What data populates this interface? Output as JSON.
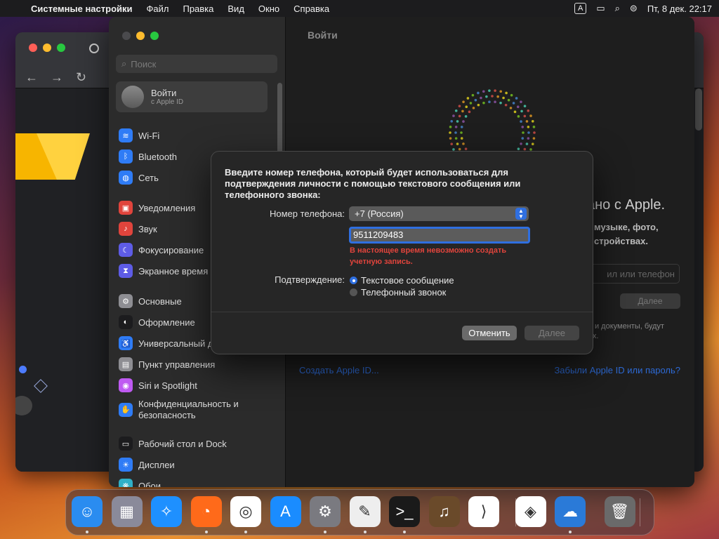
{
  "menubar": {
    "app_name": "Системные настройки",
    "items": [
      "Файл",
      "Правка",
      "Вид",
      "Окно",
      "Справка"
    ],
    "keyboard_indicator": "A",
    "datetime": "Пт, 8 дек.  22:17"
  },
  "settings": {
    "search_placeholder": "Поиск",
    "account": {
      "title": "Войти",
      "subtitle": "с Apple ID"
    },
    "sidebar": [
      {
        "label": "Wi-Fi",
        "icon": "wifi-icon",
        "color": "#2f7cf6",
        "glyph": "≋"
      },
      {
        "label": "Bluetooth",
        "icon": "bluetooth-icon",
        "color": "#2f7cf6",
        "glyph": "ᛒ"
      },
      {
        "label": "Сеть",
        "icon": "network-icon",
        "color": "#2f7cf6",
        "glyph": "◍"
      },
      {
        "label": "Уведомления",
        "icon": "notifications-icon",
        "color": "#e0443c",
        "glyph": "▣"
      },
      {
        "label": "Звук",
        "icon": "sound-icon",
        "color": "#e0443c",
        "glyph": "♪"
      },
      {
        "label": "Фокусирование",
        "icon": "focus-icon",
        "color": "#5e5ce6",
        "glyph": "☾"
      },
      {
        "label": "Экранное время",
        "icon": "screen-time-icon",
        "color": "#5e5ce6",
        "glyph": "⧗"
      },
      {
        "label": "Основные",
        "icon": "general-icon",
        "color": "#8e8e93",
        "glyph": "⚙"
      },
      {
        "label": "Оформление",
        "icon": "appearance-icon",
        "color": "#1c1c1e",
        "glyph": "◐"
      },
      {
        "label": "Универсальный доступ",
        "icon": "accessibility-icon",
        "color": "#2f7cf6",
        "glyph": "♿"
      },
      {
        "label": "Пункт управления",
        "icon": "control-center-icon",
        "color": "#8e8e93",
        "glyph": "▤"
      },
      {
        "label": "Siri и Spotlight",
        "icon": "siri-icon",
        "color": "#bf5af2",
        "glyph": "◉"
      },
      {
        "label": "Конфиденциальность и безопасность",
        "icon": "privacy-icon",
        "color": "#2f7cf6",
        "glyph": "✋"
      },
      {
        "label": "Рабочий стол и Dock",
        "icon": "desktop-dock-icon",
        "color": "#1c1c1e",
        "glyph": "▭"
      },
      {
        "label": "Дисплеи",
        "icon": "displays-icon",
        "color": "#2f7cf6",
        "glyph": "☀"
      },
      {
        "label": "Обои",
        "icon": "wallpaper-icon",
        "color": "#30b0c7",
        "glyph": "❋"
      }
    ],
    "main": {
      "title": "Войти",
      "heading": "ано с Apple.",
      "sub_line1": "музыке, фото,",
      "sub_line2": "стройствах.",
      "input_placeholder": "ил или телефон",
      "next_label": "Далее",
      "small_line1": "ы и документы, будут",
      "small_line2": "ых.",
      "create_link": "Создать Apple ID...",
      "forgot_link": "Забыли Apple ID или пароль?"
    }
  },
  "dialog": {
    "message": "Введите номер телефона, который будет использоваться для подтверждения личности с помощью текстового сообщения или телефонного звонка:",
    "phone_label": "Номер телефона:",
    "country_value": "+7 (Россия)",
    "phone_value": "9511209483",
    "error": "В настоящее время невозможно создать учетную запись.",
    "confirm_label": "Подтверждение:",
    "option_sms": "Текстовое сообщение",
    "option_call": "Телефонный звонок",
    "selected_option": "sms",
    "cancel_label": "Отменить",
    "next_label": "Далее"
  },
  "dock": [
    {
      "name": "finder-icon",
      "color": "#2a8cf0",
      "glyph": "☺"
    },
    {
      "name": "launchpad-icon",
      "color": "#8a8a9a",
      "glyph": "▦"
    },
    {
      "name": "safari-icon",
      "color": "#1e90ff",
      "glyph": "✧"
    },
    {
      "name": "firefox-icon",
      "color": "#ff6a1a",
      "glyph": "◔"
    },
    {
      "name": "chrome-icon",
      "color": "#ffffff",
      "glyph": "◎"
    },
    {
      "name": "app-store-icon",
      "color": "#1a8cff",
      "glyph": "A"
    },
    {
      "name": "system-settings-icon",
      "color": "#7a7a80",
      "glyph": "⚙"
    },
    {
      "name": "textedit-icon",
      "color": "#eeeeee",
      "glyph": "✎"
    },
    {
      "name": "terminal-icon",
      "color": "#1a1a1a",
      "glyph": ">_"
    },
    {
      "name": "garageband-icon",
      "color": "#6a4a2a",
      "glyph": "♫"
    },
    {
      "name": "vscode-icon",
      "color": "#ffffff",
      "glyph": "⟩"
    },
    {
      "name": "visual-studio-icon",
      "color": "#ffffff",
      "glyph": "◈"
    },
    {
      "name": "weather-icon",
      "color": "#2a7ad8",
      "glyph": "☁"
    },
    {
      "name": "trash-icon",
      "color": "#6a6a6a",
      "glyph": "🗑"
    }
  ]
}
